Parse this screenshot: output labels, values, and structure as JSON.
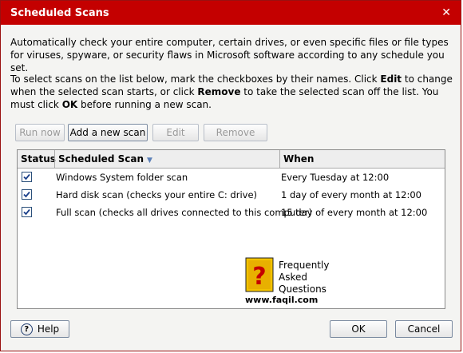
{
  "window": {
    "title": "Scheduled Scans",
    "close_glyph": "✕",
    "accent_color": "#c40000"
  },
  "intro": {
    "p1": "Automatically check your entire computer, certain drives, or even specific files or file types for viruses, spyware, or security flaws in Microsoft software according to any schedule you set.",
    "p2_a": "To select scans on the list below, mark the checkboxes by their names. Click ",
    "p2_edit": "Edit",
    "p2_b": " to change when the selected scan starts, or click ",
    "p2_remove": "Remove",
    "p2_c": " to take the selected scan off the list. You must click ",
    "p2_ok": "OK",
    "p2_d": " before running a new scan."
  },
  "toolbar": {
    "run_now": "Run now",
    "add_new_scan": "Add a new scan",
    "edit": "Edit",
    "remove": "Remove"
  },
  "table": {
    "columns": {
      "status": "Status",
      "scheduled_scan": "Scheduled Scan",
      "when": "When"
    },
    "rows": [
      {
        "checked": true,
        "name": "Windows System folder scan",
        "when": "Every Tuesday at 12:00"
      },
      {
        "checked": true,
        "name": "Hard disk scan (checks your entire C: drive)",
        "when": "1 day of every month at 12:00"
      },
      {
        "checked": true,
        "name": "Full scan (checks all drives connected to this computer)",
        "when": "15 day of every month at 12:00"
      }
    ]
  },
  "watermark": {
    "line1": "Frequently",
    "line2": "Asked",
    "line3": "Questions",
    "url": "www.faqil.com"
  },
  "footer": {
    "help": "Help",
    "ok": "OK",
    "cancel": "Cancel"
  }
}
